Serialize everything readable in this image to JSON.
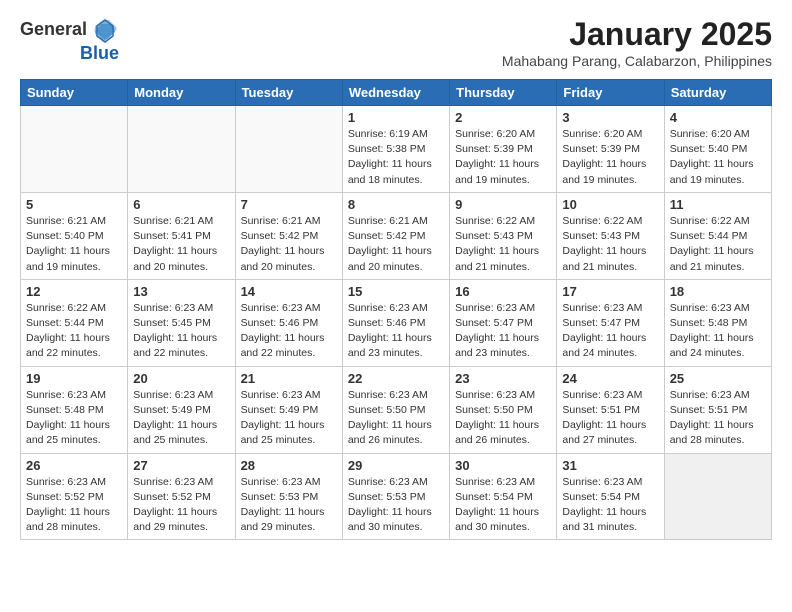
{
  "header": {
    "logo_general": "General",
    "logo_blue": "Blue",
    "month_title": "January 2025",
    "location": "Mahabang Parang, Calabarzon, Philippines"
  },
  "weekdays": [
    "Sunday",
    "Monday",
    "Tuesday",
    "Wednesday",
    "Thursday",
    "Friday",
    "Saturday"
  ],
  "weeks": [
    [
      {
        "day": "",
        "info": ""
      },
      {
        "day": "",
        "info": ""
      },
      {
        "day": "",
        "info": ""
      },
      {
        "day": "1",
        "info": "Sunrise: 6:19 AM\nSunset: 5:38 PM\nDaylight: 11 hours\nand 18 minutes."
      },
      {
        "day": "2",
        "info": "Sunrise: 6:20 AM\nSunset: 5:39 PM\nDaylight: 11 hours\nand 19 minutes."
      },
      {
        "day": "3",
        "info": "Sunrise: 6:20 AM\nSunset: 5:39 PM\nDaylight: 11 hours\nand 19 minutes."
      },
      {
        "day": "4",
        "info": "Sunrise: 6:20 AM\nSunset: 5:40 PM\nDaylight: 11 hours\nand 19 minutes."
      }
    ],
    [
      {
        "day": "5",
        "info": "Sunrise: 6:21 AM\nSunset: 5:40 PM\nDaylight: 11 hours\nand 19 minutes."
      },
      {
        "day": "6",
        "info": "Sunrise: 6:21 AM\nSunset: 5:41 PM\nDaylight: 11 hours\nand 20 minutes."
      },
      {
        "day": "7",
        "info": "Sunrise: 6:21 AM\nSunset: 5:42 PM\nDaylight: 11 hours\nand 20 minutes."
      },
      {
        "day": "8",
        "info": "Sunrise: 6:21 AM\nSunset: 5:42 PM\nDaylight: 11 hours\nand 20 minutes."
      },
      {
        "day": "9",
        "info": "Sunrise: 6:22 AM\nSunset: 5:43 PM\nDaylight: 11 hours\nand 21 minutes."
      },
      {
        "day": "10",
        "info": "Sunrise: 6:22 AM\nSunset: 5:43 PM\nDaylight: 11 hours\nand 21 minutes."
      },
      {
        "day": "11",
        "info": "Sunrise: 6:22 AM\nSunset: 5:44 PM\nDaylight: 11 hours\nand 21 minutes."
      }
    ],
    [
      {
        "day": "12",
        "info": "Sunrise: 6:22 AM\nSunset: 5:44 PM\nDaylight: 11 hours\nand 22 minutes."
      },
      {
        "day": "13",
        "info": "Sunrise: 6:23 AM\nSunset: 5:45 PM\nDaylight: 11 hours\nand 22 minutes."
      },
      {
        "day": "14",
        "info": "Sunrise: 6:23 AM\nSunset: 5:46 PM\nDaylight: 11 hours\nand 22 minutes."
      },
      {
        "day": "15",
        "info": "Sunrise: 6:23 AM\nSunset: 5:46 PM\nDaylight: 11 hours\nand 23 minutes."
      },
      {
        "day": "16",
        "info": "Sunrise: 6:23 AM\nSunset: 5:47 PM\nDaylight: 11 hours\nand 23 minutes."
      },
      {
        "day": "17",
        "info": "Sunrise: 6:23 AM\nSunset: 5:47 PM\nDaylight: 11 hours\nand 24 minutes."
      },
      {
        "day": "18",
        "info": "Sunrise: 6:23 AM\nSunset: 5:48 PM\nDaylight: 11 hours\nand 24 minutes."
      }
    ],
    [
      {
        "day": "19",
        "info": "Sunrise: 6:23 AM\nSunset: 5:48 PM\nDaylight: 11 hours\nand 25 minutes."
      },
      {
        "day": "20",
        "info": "Sunrise: 6:23 AM\nSunset: 5:49 PM\nDaylight: 11 hours\nand 25 minutes."
      },
      {
        "day": "21",
        "info": "Sunrise: 6:23 AM\nSunset: 5:49 PM\nDaylight: 11 hours\nand 25 minutes."
      },
      {
        "day": "22",
        "info": "Sunrise: 6:23 AM\nSunset: 5:50 PM\nDaylight: 11 hours\nand 26 minutes."
      },
      {
        "day": "23",
        "info": "Sunrise: 6:23 AM\nSunset: 5:50 PM\nDaylight: 11 hours\nand 26 minutes."
      },
      {
        "day": "24",
        "info": "Sunrise: 6:23 AM\nSunset: 5:51 PM\nDaylight: 11 hours\nand 27 minutes."
      },
      {
        "day": "25",
        "info": "Sunrise: 6:23 AM\nSunset: 5:51 PM\nDaylight: 11 hours\nand 28 minutes."
      }
    ],
    [
      {
        "day": "26",
        "info": "Sunrise: 6:23 AM\nSunset: 5:52 PM\nDaylight: 11 hours\nand 28 minutes."
      },
      {
        "day": "27",
        "info": "Sunrise: 6:23 AM\nSunset: 5:52 PM\nDaylight: 11 hours\nand 29 minutes."
      },
      {
        "day": "28",
        "info": "Sunrise: 6:23 AM\nSunset: 5:53 PM\nDaylight: 11 hours\nand 29 minutes."
      },
      {
        "day": "29",
        "info": "Sunrise: 6:23 AM\nSunset: 5:53 PM\nDaylight: 11 hours\nand 30 minutes."
      },
      {
        "day": "30",
        "info": "Sunrise: 6:23 AM\nSunset: 5:54 PM\nDaylight: 11 hours\nand 30 minutes."
      },
      {
        "day": "31",
        "info": "Sunrise: 6:23 AM\nSunset: 5:54 PM\nDaylight: 11 hours\nand 31 minutes."
      },
      {
        "day": "",
        "info": ""
      }
    ]
  ]
}
